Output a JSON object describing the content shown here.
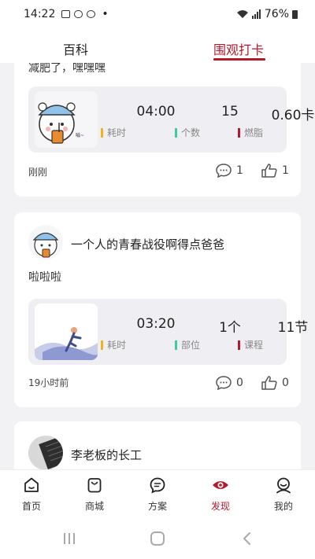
{
  "status_bar": {
    "time": "14:22",
    "dot": "•",
    "battery": "76%"
  },
  "top_tabs": [
    {
      "label": "百科"
    },
    {
      "label": "围观打卡"
    }
  ],
  "posts": [
    {
      "caption": "减肥了，嘿嘿嘿",
      "stats": [
        {
          "value": "04:00",
          "label": "耗时",
          "color": "#f2b21a"
        },
        {
          "value": "15",
          "label": "个数",
          "color": "#3cc9a6"
        },
        {
          "value": "0.60卡",
          "label": "燃脂",
          "color": "#b3182c"
        }
      ],
      "time": "刚刚",
      "comments": "1",
      "likes": "1"
    },
    {
      "username": "一个人的青春战役啊得点爸爸",
      "caption": "啦啦啦",
      "stats": [
        {
          "value": "03:20",
          "label": "耗时",
          "color": "#f2b21a"
        },
        {
          "value": "1个",
          "label": "部位",
          "color": "#3cc9a6"
        },
        {
          "value": "11节",
          "label": "课程",
          "color": "#b3182c"
        }
      ],
      "time": "19小时前",
      "comments": "0",
      "likes": "0"
    },
    {
      "username": "李老板的长工"
    }
  ],
  "bottom_nav": [
    {
      "label": "首页",
      "icon": "home-icon"
    },
    {
      "label": "商城",
      "icon": "shopping-bag-icon"
    },
    {
      "label": "方案",
      "icon": "chat-plan-icon"
    },
    {
      "label": "发现",
      "icon": "eye-icon",
      "active": true
    },
    {
      "label": "我的",
      "icon": "profile-icon"
    }
  ],
  "colors": {
    "accent": "#b3182c",
    "yellow": "#f2b21a",
    "teal": "#3cc9a6"
  }
}
